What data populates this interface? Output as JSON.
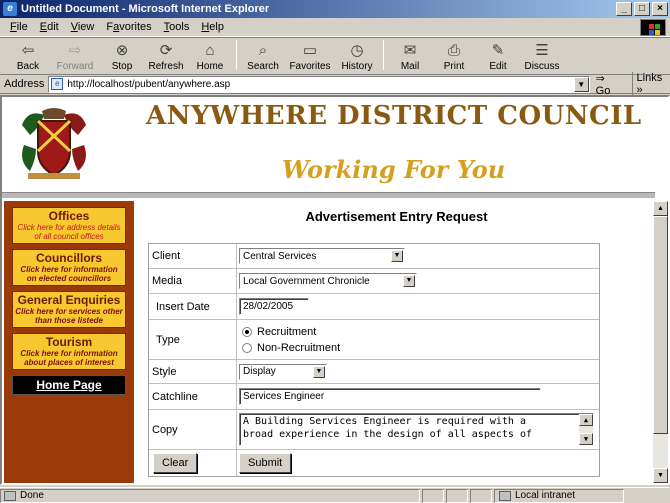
{
  "window": {
    "title": "Untitled Document - Microsoft Internet Explorer",
    "buttons": [
      "_",
      "□",
      "×"
    ]
  },
  "menu": [
    {
      "key": "F",
      "rest": "ile"
    },
    {
      "key": "E",
      "rest": "dit"
    },
    {
      "key": "V",
      "rest": "iew"
    },
    {
      "key": "a",
      "pre": "F",
      "rest": "vorites"
    },
    {
      "key": "T",
      "rest": "ools"
    },
    {
      "key": "H",
      "rest": "elp"
    }
  ],
  "toolbar": {
    "back": "Back",
    "forward": "Forward",
    "stop": "Stop",
    "refresh": "Refresh",
    "home": "Home",
    "search": "Search",
    "favorites": "Favorites",
    "history": "History",
    "mail": "Mail",
    "print": "Print",
    "edit": "Edit",
    "discuss": "Discuss"
  },
  "address": {
    "label": "Address",
    "url": "http://localhost/pubent/anywhere.asp",
    "go": "Go",
    "links": "Links »"
  },
  "header": {
    "council_name": "ANYWHERE DISTRICT COUNCIL",
    "tagline": "Working For You"
  },
  "sidebar": {
    "items": [
      {
        "title": "Offices",
        "desc": "Click here for address details of all council offices"
      },
      {
        "title": "Councillors",
        "desc": "Click here for information on elected councillors"
      },
      {
        "title": "General Enquiries",
        "desc": "Click here for services other than those listede"
      },
      {
        "title": "Tourism",
        "desc": "Click here for information about places of interest"
      }
    ],
    "home": "Home Page"
  },
  "form": {
    "title": "Advertisement Entry Request",
    "client_label": "Client",
    "client_value": "Central Services",
    "media_label": "Media",
    "media_value": "Local Government Chronicle",
    "date_label": "Insert Date",
    "date_value": "28/02/2005",
    "type_label": "Type",
    "type_opt1": "Recruitment",
    "type_opt2": "Non-Recruitment",
    "style_label": "Style",
    "style_value": "Display",
    "catchline_label": "Catchline",
    "catchline_value": "Services Engineer",
    "copy_label": "Copy",
    "copy_line1": "A Building Services Engineer is required with a",
    "copy_line2": "broad experience in the design of all aspects of",
    "clear": "Clear",
    "submit": "Submit"
  },
  "status": {
    "text": "Done",
    "zone": "Local intranet"
  }
}
